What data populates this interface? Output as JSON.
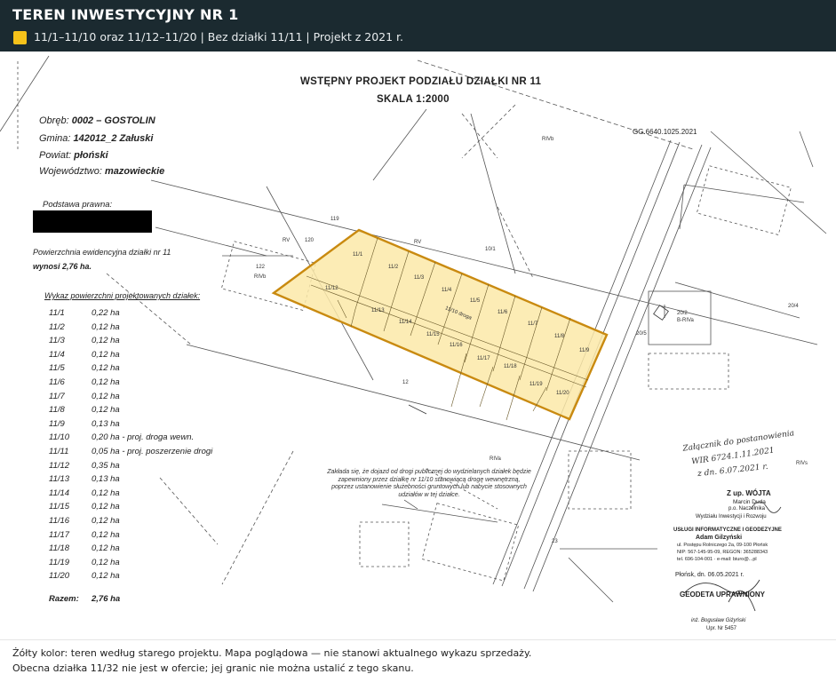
{
  "header": {
    "title": "TEREN INWESTYCYJNY NR 1",
    "subtitle": "11/1–11/10 oraz 11/12–11/20  |  Bez działki 11/11  |  Projekt z 2021 r.",
    "legend_color": "#f6c21a"
  },
  "map": {
    "title_line1": "WSTĘPNY PROJEKT PODZIAŁU DZIAŁKI NR 11",
    "title_line2": "SKALA 1:2000",
    "ref_code": "GG.6640.1025.2021",
    "info": {
      "obreb_label": "Obręb:",
      "obreb_value": "0002 – GOSTOLIN",
      "gmina_label": "Gmina:",
      "gmina_value": "142012_2 Załuski",
      "powiat_label": "Powiat:",
      "powiat_value": "płoński",
      "woj_label": "Województwo:",
      "woj_value": "mazowieckie",
      "podstawa": "Podstawa prawna:",
      "powierzchnia_line1": "Powierzchnia ewidencyjna działki nr 11",
      "powierzchnia_line2": "wynosi 2,76 ha."
    },
    "list_title": "Wykaz powierzchni projektowanych działek:",
    "list": [
      {
        "id": "11/1",
        "area": "0,22 ha"
      },
      {
        "id": "11/2",
        "area": "0,12 ha"
      },
      {
        "id": "11/3",
        "area": "0,12 ha"
      },
      {
        "id": "11/4",
        "area": "0,12 ha"
      },
      {
        "id": "11/5",
        "area": "0,12 ha"
      },
      {
        "id": "11/6",
        "area": "0,12 ha"
      },
      {
        "id": "11/7",
        "area": "0,12 ha"
      },
      {
        "id": "11/8",
        "area": "0,12 ha"
      },
      {
        "id": "11/9",
        "area": "0,13 ha"
      },
      {
        "id": "11/10",
        "area": "0,20 ha - proj. droga wewn."
      },
      {
        "id": "11/11",
        "area": "0,05 ha - proj. poszerzenie drogi"
      },
      {
        "id": "11/12",
        "area": "0,35 ha"
      },
      {
        "id": "11/13",
        "area": "0,13 ha"
      },
      {
        "id": "11/14",
        "area": "0,12 ha"
      },
      {
        "id": "11/15",
        "area": "0,12 ha"
      },
      {
        "id": "11/16",
        "area": "0,12 ha"
      },
      {
        "id": "11/17",
        "area": "0,12 ha"
      },
      {
        "id": "11/18",
        "area": "0,12 ha"
      },
      {
        "id": "11/19",
        "area": "0,12 ha"
      },
      {
        "id": "11/20",
        "area": "0,12 ha"
      }
    ],
    "total_label": "Razem:",
    "total_value": "2,76 ha",
    "plot_labels": {
      "p11_1": "11/1",
      "p11_2": "11/2",
      "p11_3": "11/3",
      "p11_4": "11/4",
      "p11_5": "11/5",
      "p11_6": "11/6",
      "p11_7": "11/7",
      "p11_8": "11/8",
      "p11_9": "11/9",
      "p11_10": "11/10 droga",
      "p11_12": "11/12",
      "p11_13": "11/13",
      "p11_14": "11/14",
      "p11_15": "11/15",
      "p11_16": "11/16",
      "p11_17": "11/17",
      "p11_18": "11/18",
      "p11_19": "11/19",
      "p11_20": "11/20"
    },
    "map_labels": {
      "rvb_top": "RIVb",
      "n119": "119",
      "n120": "120",
      "rv1": "RV",
      "rv2": "RV",
      "n10_1": "10/1",
      "n122": "122",
      "rivb_left": "RIVb",
      "n20_2": "20/2",
      "b_riva": "B-RIVa",
      "n20_5": "20/5",
      "n20_4": "20/4",
      "n12": "12",
      "riva_bottom": "RIVa",
      "n23": "23",
      "rivs_right": "RIVs"
    },
    "note": "Zakłada się, że dojazd od drogi publicznej do wydzielanych działek będzie zapewniony przez działkę nr 11/10 stanowiącą drogę wewnętrzną, poprzez ustanowienie służebności gruntowych lub nabycie stosownych udziałów w tej działce.",
    "handwritten": {
      "line1": "Załącznik do postanowienia",
      "line2": "WIR 6724.1.11.2021",
      "line3": "z dn. 6.07.2021 r."
    },
    "stamp_wojt": {
      "line1": "Z up. WÓJTA",
      "line2": "Marcin Duda",
      "line3": "p.o. Naczelnika",
      "line4": "Wydziału Inwestycji i Rozwoju"
    },
    "stamp_company": {
      "line1": "USŁUGI INFORMATYCZNE I GEODEZYJNE",
      "line2": "Adam Gilzyński",
      "line3": "ul. Postępu Rolniczego 2a, 09-100 Płońsk",
      "line4": "NIP: 567-145-95-09, REGON: 365288343",
      "line5": "tel. 696-104-001 · e-mail: biuro@...pl"
    },
    "place_date": "Płońsk, dn. 06.05.2021 r.",
    "stamp_geodeta": {
      "line1": "GEODETA UPRAWNIONY",
      "line2": "inż. Bogusław Giżyński",
      "line3": "Upr. Nr 5457"
    }
  },
  "footer": {
    "line1": "Żółty kolor: teren według starego projektu. Mapa poglądowa — nie stanowi aktualnego wykazu sprzedaży.",
    "line2": "Obecna działka 11/32 nie jest w ofercie; jej granic nie można ustalić z tego skanu."
  }
}
